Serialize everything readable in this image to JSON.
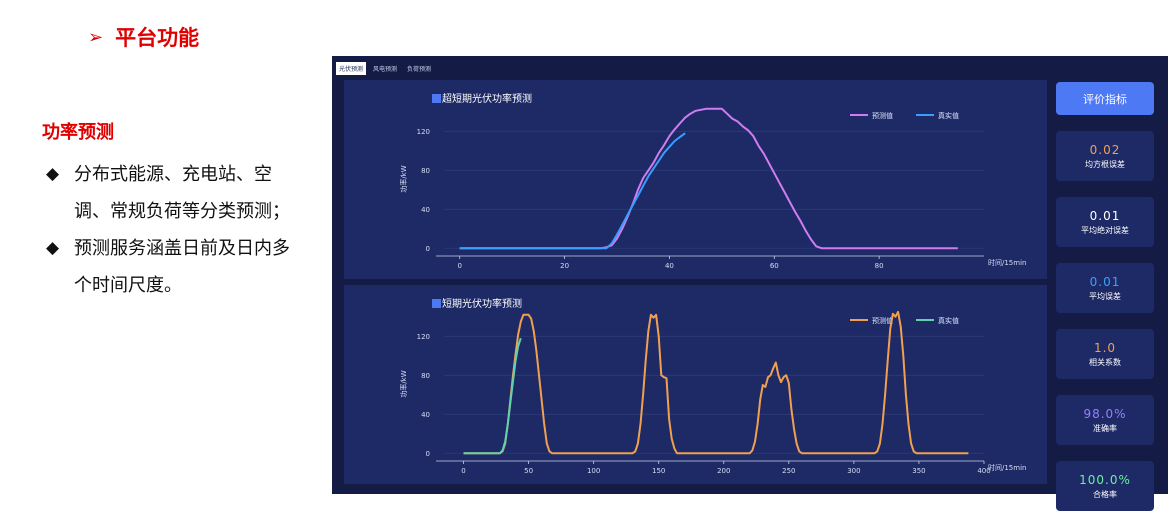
{
  "slide": {
    "title_arrow": "➢",
    "title": "平台功能",
    "subtitle": "功率预测",
    "bullets": [
      {
        "marker": "◆",
        "text": "分布式能源、充电站、空调、常规负荷等分类预测；"
      },
      {
        "marker": "◆",
        "text": "预测服务涵盖日前及日内多个时间尺度。"
      }
    ]
  },
  "app": {
    "tabs": [
      {
        "label": "光伏预测",
        "active": true
      },
      {
        "label": "风电预测",
        "active": false
      },
      {
        "label": "负荷预测",
        "active": false
      }
    ],
    "evaluate_button": "评价指标",
    "metrics": [
      {
        "value": "0.02",
        "label": "均方根误差",
        "color": "#f0a050"
      },
      {
        "value": "0.01",
        "label": "平均绝对误差",
        "color": "#ffffff"
      },
      {
        "value": "0.01",
        "label": "平均误差",
        "color": "#3aa0ff"
      },
      {
        "value": "1.0",
        "label": "相关系数",
        "color": "#f0a050"
      },
      {
        "value": "98.0%",
        "label": "准确率",
        "color": "#9a7dff"
      },
      {
        "value": "100.0%",
        "label": "合格率",
        "color": "#6ef0a0"
      }
    ]
  },
  "chart_data": [
    {
      "type": "line",
      "title": "超短期光伏功率预测",
      "xlabel": "时间/15min",
      "ylabel": "功率/kW",
      "xlim": [
        -3,
        100
      ],
      "ylim": [
        -8,
        150
      ],
      "xticks": [
        0,
        20,
        40,
        60,
        80
      ],
      "yticks": [
        0,
        40,
        80,
        120
      ],
      "legend_position": "top-right",
      "grid": true,
      "series": [
        {
          "name": "预测值",
          "color": "#d07cf0",
          "x": [
            0,
            27,
            28,
            29,
            30,
            31,
            32,
            33,
            34,
            35,
            36,
            37,
            38,
            39,
            40,
            41,
            42,
            43,
            44,
            45,
            46,
            47,
            48,
            49,
            50,
            51,
            52,
            53,
            54,
            55,
            56,
            57,
            58,
            59,
            60,
            61,
            62,
            63,
            64,
            65,
            66,
            67,
            68,
            69,
            95
          ],
          "y": [
            0,
            0,
            1,
            3,
            10,
            20,
            32,
            45,
            60,
            72,
            80,
            88,
            98,
            106,
            115,
            122,
            128,
            134,
            138,
            141,
            142,
            143,
            143,
            143,
            143,
            138,
            133,
            130,
            125,
            121,
            115,
            105,
            97,
            87,
            77,
            67,
            57,
            47,
            37,
            28,
            18,
            9,
            2,
            0,
            0
          ]
        },
        {
          "name": "真实值",
          "color": "#3a9dff",
          "x": [
            0,
            28,
            29,
            30,
            31,
            32,
            33,
            34,
            35,
            36,
            37,
            38,
            39,
            40,
            41,
            42,
            43
          ],
          "y": [
            0,
            0,
            5,
            14,
            24,
            34,
            44,
            54,
            64,
            74,
            82,
            90,
            98,
            104,
            110,
            114,
            118
          ]
        }
      ]
    },
    {
      "type": "line",
      "title": "短期光伏功率预测",
      "xlabel": "时间/15min",
      "ylabel": "功率/kW",
      "xlim": [
        -15,
        400
      ],
      "ylim": [
        -8,
        150
      ],
      "xticks": [
        0,
        50,
        100,
        150,
        200,
        250,
        300,
        350,
        400
      ],
      "yticks": [
        0,
        40,
        80,
        120
      ],
      "legend_position": "top-right",
      "grid": true,
      "series": [
        {
          "name": "预测值",
          "color": "#f0a050",
          "x": [
            0,
            28,
            30,
            32,
            34,
            36,
            38,
            40,
            42,
            44,
            46,
            48,
            50,
            52,
            54,
            56,
            58,
            60,
            62,
            64,
            66,
            68,
            70,
            72,
            130,
            132,
            134,
            136,
            138,
            140,
            142,
            144,
            146,
            148,
            150,
            152,
            154,
            156,
            158,
            160,
            162,
            164,
            166,
            168,
            170,
            220,
            222,
            224,
            226,
            228,
            230,
            232,
            234,
            236,
            238,
            240,
            242,
            244,
            246,
            248,
            250,
            252,
            254,
            256,
            258,
            260,
            262,
            316,
            318,
            320,
            322,
            324,
            326,
            328,
            330,
            332,
            334,
            336,
            338,
            340,
            342,
            344,
            346,
            348,
            350,
            352,
            354,
            356,
            358,
            360,
            388
          ],
          "y": [
            0,
            0,
            2,
            10,
            30,
            55,
            80,
            102,
            122,
            135,
            142,
            142,
            142,
            138,
            125,
            105,
            80,
            55,
            30,
            10,
            2,
            0,
            0,
            0,
            0,
            2,
            10,
            30,
            60,
            95,
            125,
            142,
            139,
            142,
            120,
            80,
            78,
            77,
            35,
            15,
            5,
            0,
            0,
            0,
            0,
            0,
            3,
            12,
            30,
            55,
            70,
            68,
            78,
            80,
            87,
            93,
            80,
            73,
            78,
            80,
            72,
            45,
            25,
            10,
            2,
            0,
            0,
            0,
            2,
            10,
            30,
            60,
            95,
            128,
            143,
            140,
            145,
            130,
            100,
            60,
            30,
            10,
            2,
            0,
            0,
            0,
            0,
            0,
            0,
            0,
            0
          ]
        },
        {
          "name": "真实值",
          "color": "#60d0b0",
          "x": [
            0,
            28,
            30,
            32,
            34,
            36,
            38,
            40,
            42,
            44
          ],
          "y": [
            0,
            0,
            3,
            12,
            30,
            52,
            74,
            95,
            110,
            118
          ]
        }
      ]
    }
  ]
}
